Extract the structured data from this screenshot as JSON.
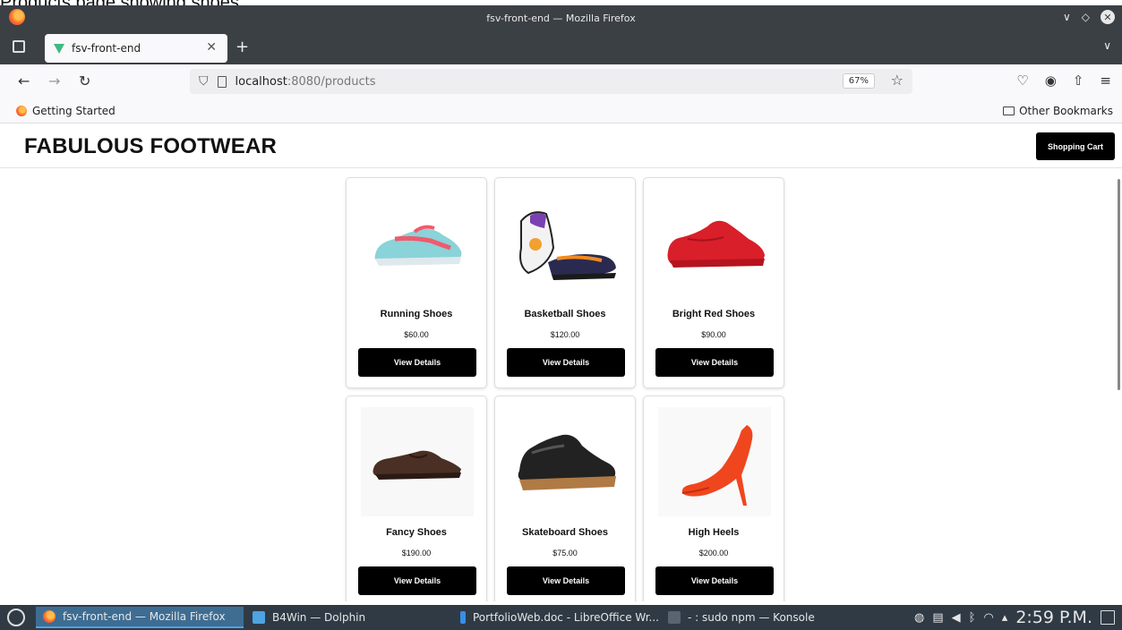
{
  "caption": "Products page showing shoes",
  "window": {
    "title": "fsv-front-end — Mozilla Firefox"
  },
  "tabs": [
    {
      "label": "fsv-front-end"
    }
  ],
  "address": {
    "host": "localhost",
    "path": ":8080/products",
    "zoom": "67%"
  },
  "bookmarks": {
    "getting_started": "Getting Started",
    "other": "Other Bookmarks"
  },
  "site": {
    "title": "FABULOUS FOOTWEAR",
    "cart_label": "Shopping Cart"
  },
  "products": [
    {
      "name": "Running Shoes",
      "price": "$60.00",
      "button": "View Details",
      "image": "running-shoe-image"
    },
    {
      "name": "Basketball Shoes",
      "price": "$120.00",
      "button": "View Details",
      "image": "basketball-shoe-image"
    },
    {
      "name": "Bright Red Shoes",
      "price": "$90.00",
      "button": "View Details",
      "image": "red-shoe-image"
    },
    {
      "name": "Fancy Shoes",
      "price": "$190.00",
      "button": "View Details",
      "image": "oxford-shoe-image"
    },
    {
      "name": "Skateboard Shoes",
      "price": "$75.00",
      "button": "View Details",
      "image": "skate-shoe-image"
    },
    {
      "name": "High Heels",
      "price": "$200.00",
      "button": "View Details",
      "image": "high-heel-image"
    }
  ],
  "taskbar": {
    "tasks": [
      {
        "label": "fsv-front-end — Mozilla Firefox"
      },
      {
        "label": "B4Win — Dolphin"
      },
      {
        "label": "PortfolioWeb.doc - LibreOffice Wr..."
      },
      {
        "label": "- : sudo npm — Konsole"
      }
    ],
    "clock": "2:59 P.M."
  }
}
